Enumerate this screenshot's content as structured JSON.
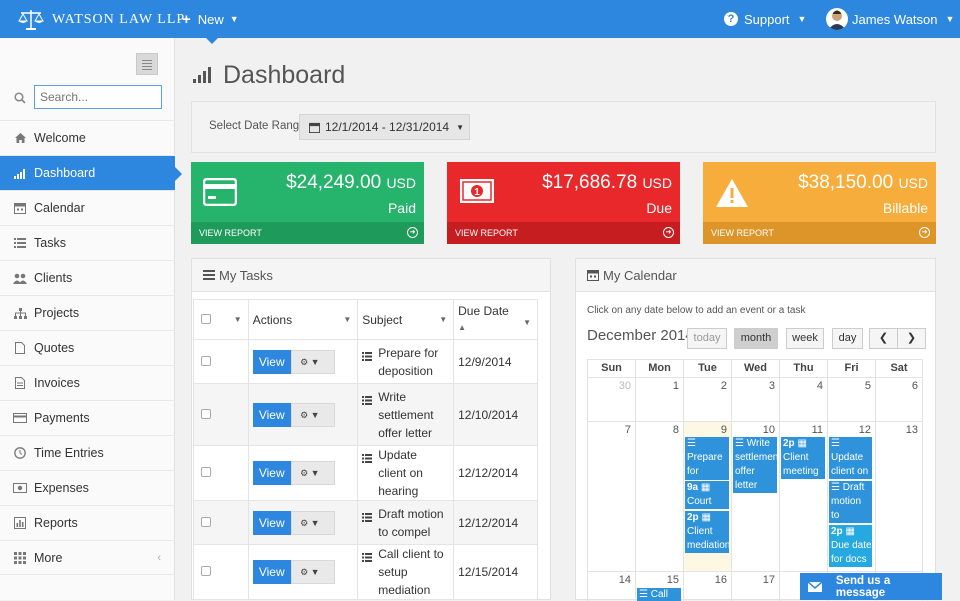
{
  "header": {
    "brand": "WATSON LAW LLP",
    "new_label": "New",
    "support_label": "Support",
    "user_name": "James Watson"
  },
  "sidebar": {
    "search_placeholder": "Search...",
    "items": [
      {
        "label": "Welcome",
        "icon": "home-icon"
      },
      {
        "label": "Dashboard",
        "icon": "signal-bars-icon",
        "active": true
      },
      {
        "label": "Calendar",
        "icon": "calendar-icon"
      },
      {
        "label": "Tasks",
        "icon": "list-icon"
      },
      {
        "label": "Clients",
        "icon": "users-icon"
      },
      {
        "label": "Projects",
        "icon": "sitemap-icon"
      },
      {
        "label": "Quotes",
        "icon": "document-icon"
      },
      {
        "label": "Invoices",
        "icon": "invoice-icon"
      },
      {
        "label": "Payments",
        "icon": "credit-card-icon"
      },
      {
        "label": "Time Entries",
        "icon": "clock-icon"
      },
      {
        "label": "Expenses",
        "icon": "money-icon"
      },
      {
        "label": "Reports",
        "icon": "bar-chart-icon"
      },
      {
        "label": "More",
        "icon": "grid-icon"
      }
    ]
  },
  "main": {
    "title": "Dashboard",
    "date_range_label": "Select Date Range:",
    "date_range_value": "12/1/2014 - 12/31/2014"
  },
  "stats": [
    {
      "amount": "$24,249.00",
      "currency": "USD",
      "label": "Paid",
      "footer": "VIEW REPORT",
      "color": "#26b36b",
      "footer_color": "#1e9a5b",
      "icon": "card-icon"
    },
    {
      "amount": "$17,686.78",
      "currency": "USD",
      "label": "Due",
      "footer": "VIEW REPORT",
      "color": "#e8282a",
      "footer_color": "#c61d20",
      "icon": "cash-icon"
    },
    {
      "amount": "$38,150.00",
      "currency": "USD",
      "label": "Billable",
      "footer": "VIEW REPORT",
      "color": "#f6ad3b",
      "footer_color": "#dd952a",
      "icon": "warning-icon"
    }
  ],
  "tasks": {
    "title": "My Tasks",
    "columns": {
      "actions": "Actions",
      "subject": "Subject",
      "due": "Due Date"
    },
    "view_label": "View",
    "rows": [
      {
        "subject": "Prepare for deposition",
        "due": "12/9/2014"
      },
      {
        "subject": "Write settlement offer letter",
        "due": "12/10/2014"
      },
      {
        "subject": "Update client on hearing",
        "due": "12/12/2014"
      },
      {
        "subject": "Draft motion to compel",
        "due": "12/12/2014"
      },
      {
        "subject": "Call client to setup mediation",
        "due": "12/15/2014"
      }
    ]
  },
  "calendar": {
    "title": "My Calendar",
    "hint": "Click on any date below to add an event or a task",
    "month": "December 2014",
    "today_label": "today",
    "views": [
      "month",
      "week",
      "day"
    ],
    "weekdays": [
      "Sun",
      "Mon",
      "Tue",
      "Wed",
      "Thu",
      "Fri",
      "Sat"
    ],
    "week1": [
      "30",
      "1",
      "2",
      "3",
      "4",
      "5",
      "6"
    ],
    "week2": [
      "7",
      "8",
      "9",
      "10",
      "11",
      "12",
      "13"
    ],
    "week3": [
      "14",
      "15",
      "16",
      "17"
    ],
    "today": "9",
    "events": {
      "tue_1": "Prepare for",
      "tue_2_time": "9a",
      "tue_2_text": "Court",
      "tue_3_time": "2p",
      "tue_3_text": "Client mediation",
      "wed_1": "Write settlement offer letter",
      "thu_1_time": "2p",
      "thu_1_text": "Client meeting",
      "fri_1": "Update client on",
      "fri_2": "Draft motion to compel",
      "fri_3": "Due date for docs",
      "mon3_1": "Call"
    }
  },
  "chat": {
    "label": "Send us a message"
  }
}
